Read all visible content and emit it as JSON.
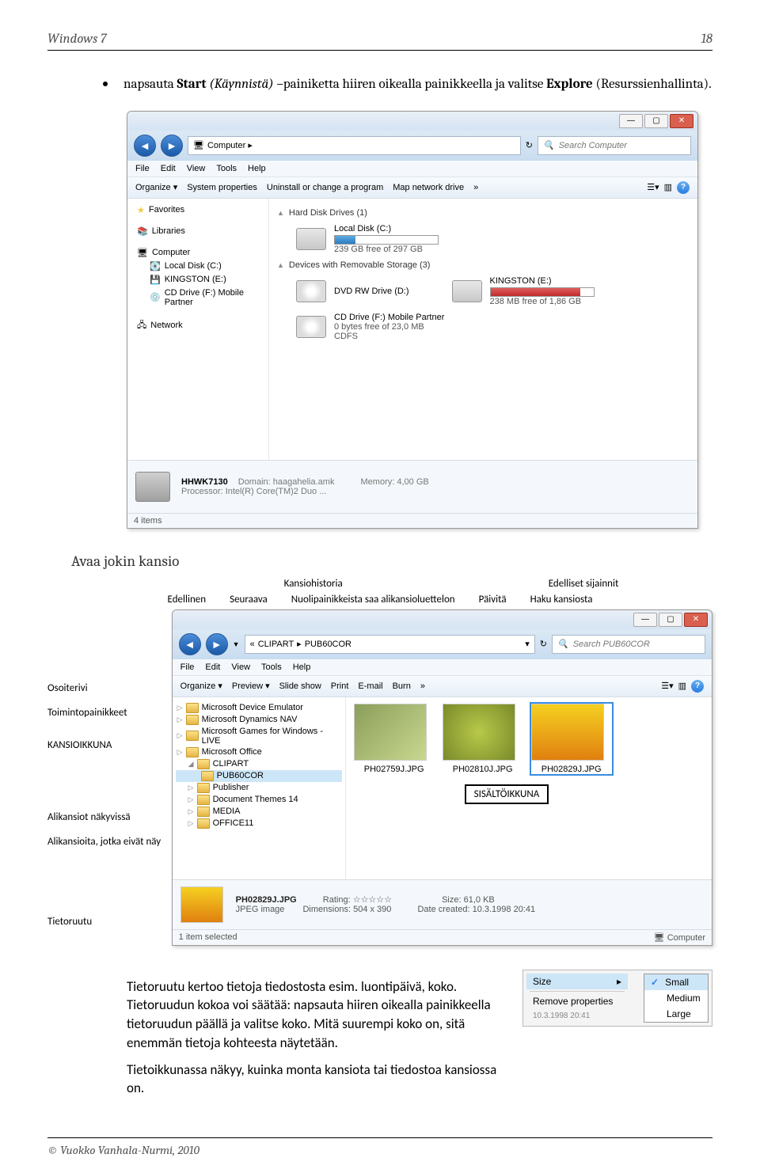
{
  "header": {
    "left": "Windows 7",
    "right": "18"
  },
  "bullet": {
    "pre": "napsauta ",
    "b1": "Start",
    "paren": " (Käynnistä)",
    "mid": " –painiketta hiiren oikealla painikkeella ja valitse ",
    "b2": "Explore",
    "tail": " (Resurssienhallinta)."
  },
  "win1": {
    "breadcrumb_icon": "▸",
    "breadcrumb": "Computer ▸",
    "search_placeholder": "Search Computer",
    "menu": [
      "File",
      "Edit",
      "View",
      "Tools",
      "Help"
    ],
    "toolbar": {
      "organize": "Organize ▾",
      "sysprops": "System properties",
      "uninstall": "Uninstall or change a program",
      "mapdrive": "Map network drive",
      "more": "»"
    },
    "side": {
      "favorites": "Favorites",
      "libraries": "Libraries",
      "computer": "Computer",
      "localdisk": "Local Disk (C:)",
      "kingston": "KINGSTON (E:)",
      "cddrive": "CD Drive (F:) Mobile Partner",
      "network": "Network"
    },
    "groups": {
      "hdd": "Hard Disk Drives (1)",
      "removable": "Devices with Removable Storage (3)"
    },
    "drives": {
      "c_name": "Local Disk (C:)",
      "c_free": "239 GB free of 297 GB",
      "dvd_name": "DVD RW Drive (D:)",
      "king_name": "KINGSTON (E:)",
      "king_free": "238 MB free of 1,86 GB",
      "f_name": "CD Drive (F:) Mobile Partner",
      "f_sub": "0 bytes free of 23,0 MB",
      "f_sub2": "CDFS"
    },
    "details": {
      "name": "HHWK7130",
      "domain_lbl": "Domain:",
      "domain": "haagahelia.amk",
      "mem_lbl": "Memory:",
      "mem": "4,00 GB",
      "proc_lbl": "Processor:",
      "proc": "Intel(R) Core(TM)2 Duo ..."
    },
    "status": "4 items"
  },
  "section2_head": "Avaa jokin kansio",
  "callouts": {
    "top": [
      "Kansiohistoria",
      "Edelliset sijainnit"
    ],
    "bottom": [
      "Edellinen",
      "Seuraava",
      "Nuolipainikkeista saa alikansioluettelon",
      "Päivitä",
      "Haku kansiosta"
    ],
    "left": [
      "Osoiterivi",
      "Toimintopainikkeet",
      "KANSIOIKKUNA",
      "Alikansiot näkyvissä",
      "Alikansioita, jotka eivät näy",
      "Tietoruutu"
    ],
    "content_box": "SISÄLTÖIKKUNA"
  },
  "win2": {
    "bc1": "CLIPART",
    "bc2": "PUB60COR",
    "search_placeholder": "Search PUB60COR",
    "menu": [
      "File",
      "Edit",
      "View",
      "Tools",
      "Help"
    ],
    "toolbar": {
      "organize": "Organize ▾",
      "preview": "Preview ▾",
      "slideshow": "Slide show",
      "print": "Print",
      "email": "E-mail",
      "burn": "Burn",
      "more": "»"
    },
    "tree": [
      "Microsoft Device Emulator",
      "Microsoft Dynamics NAV",
      "Microsoft Games for Windows - LIVE",
      "Microsoft Office",
      "CLIPART",
      "PUB60COR",
      "Publisher",
      "Document Themes 14",
      "MEDIA",
      "OFFICE11"
    ],
    "thumbs": [
      "PH02759J.JPG",
      "PH02810J.JPG",
      "PH02829J.JPG"
    ],
    "details": {
      "name": "PH02829J.JPG",
      "type": "JPEG image",
      "rating_lbl": "Rating:",
      "dim_lbl": "Dimensions:",
      "dim": "504 x 390",
      "size_lbl": "Size:",
      "size": "61,0 KB",
      "date_lbl": "Date created:",
      "date": "10.3.1998 20:41"
    },
    "status": "1 item selected",
    "status_right": "Computer"
  },
  "para": {
    "p1": "Tietoruutu kertoo tietoja tiedostosta esim. luontipäivä, koko. Tietoruudun kokoa voi säätää: napsauta hiiren oikealla painikkeella tietoruudun päällä ja valitse koko. Mitä suurempi koko on, sitä enemmän tietoja kohteesta näytetään.",
    "p2": "Tietoikkunassa näkyy, kuinka monta kansiota tai tiedostoa kansiossa on."
  },
  "context": {
    "size": "Size",
    "remove": "Remove properties",
    "bottom_date": "10.3.1998 20:41",
    "small": "Small",
    "medium": "Medium",
    "large": "Large"
  },
  "footer": "© Vuokko Vanhala-Nurmi, 2010"
}
